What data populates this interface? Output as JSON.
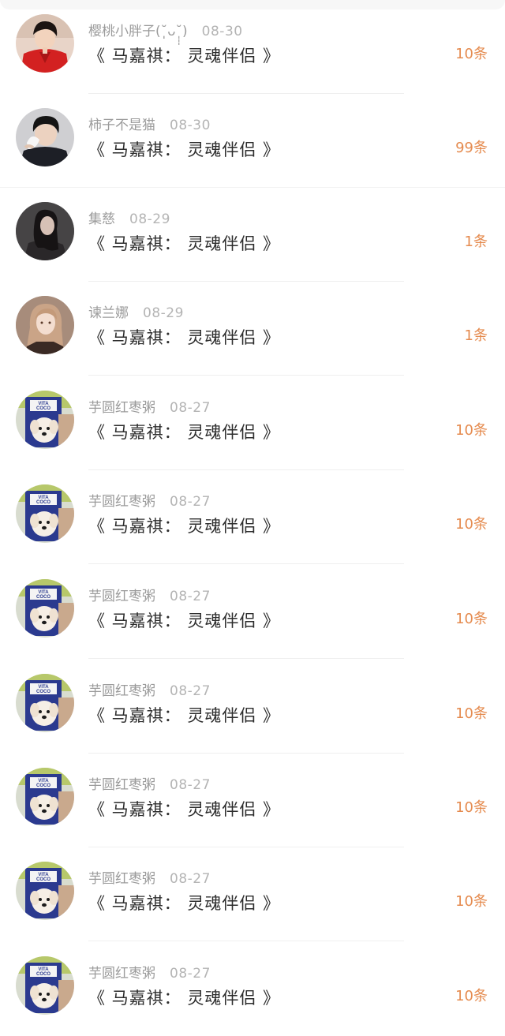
{
  "items": [
    {
      "user": "樱桃小胖子(˘̩̩̩ᴗ˘̩̩̩)",
      "date": "08-30",
      "title": "《 马嘉祺： 灵魂伴侣 》",
      "count": "10条",
      "avatar": "avatar-red-shirt-boy"
    },
    {
      "user": "柿子不是猫",
      "date": "08-30",
      "title": "《 马嘉祺： 灵魂伴侣 》",
      "count": "99条",
      "avatar": "avatar-boy-tissue"
    },
    {
      "user": "集慈",
      "date": "08-29",
      "title": "《 马嘉祺： 灵魂伴侣 》",
      "count": "1条",
      "avatar": "avatar-dark-hair-girl"
    },
    {
      "user": "谏兰娜",
      "date": "08-29",
      "title": "《 马嘉祺： 灵魂伴侣 》",
      "count": "1条",
      "avatar": "avatar-anime-girl"
    },
    {
      "user": "芋圆红枣粥",
      "date": "08-27",
      "title": "《 马嘉祺： 灵魂伴侣 》",
      "count": "10条",
      "avatar": "avatar-puppy-vitacoco"
    },
    {
      "user": "芋圆红枣粥",
      "date": "08-27",
      "title": "《 马嘉祺： 灵魂伴侣 》",
      "count": "10条",
      "avatar": "avatar-puppy-vitacoco"
    },
    {
      "user": "芋圆红枣粥",
      "date": "08-27",
      "title": "《 马嘉祺： 灵魂伴侣 》",
      "count": "10条",
      "avatar": "avatar-puppy-vitacoco"
    },
    {
      "user": "芋圆红枣粥",
      "date": "08-27",
      "title": "《 马嘉祺： 灵魂伴侣 》",
      "count": "10条",
      "avatar": "avatar-puppy-vitacoco"
    },
    {
      "user": "芋圆红枣粥",
      "date": "08-27",
      "title": "《 马嘉祺： 灵魂伴侣 》",
      "count": "10条",
      "avatar": "avatar-puppy-vitacoco"
    },
    {
      "user": "芋圆红枣粥",
      "date": "08-27",
      "title": "《 马嘉祺： 灵魂伴侣 》",
      "count": "10条",
      "avatar": "avatar-puppy-vitacoco"
    },
    {
      "user": "芋圆红枣粥",
      "date": "08-27",
      "title": "《 马嘉祺： 灵魂伴侣 》",
      "count": "10条",
      "avatar": "avatar-puppy-vitacoco"
    }
  ],
  "avatar_logo_text": "VITA COCO",
  "colors": {
    "count": "#e58b4f",
    "meta": "#9b9b9b",
    "title": "#2d2d2d",
    "separator": "#efefef"
  }
}
